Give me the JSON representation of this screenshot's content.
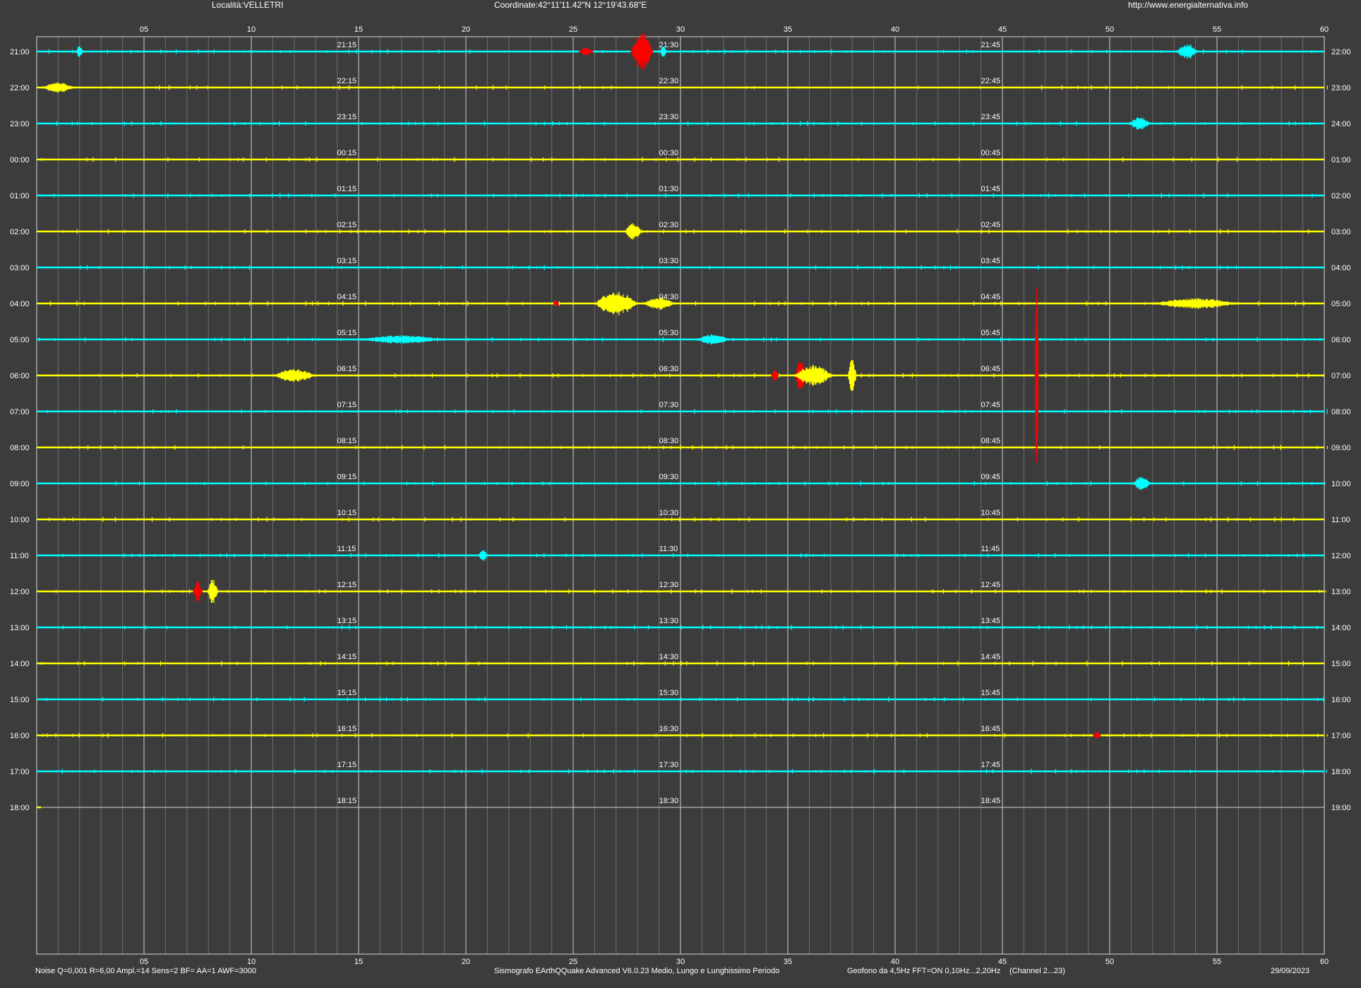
{
  "header": {
    "location": "Località:VELLETRI",
    "coordinates": "Coordinate:42°11'11.42\"N  12°19'43.68\"E",
    "website": "http://www.energialternativa.info"
  },
  "footer": {
    "params": "Noise Q=0,001 R=6,00 Ampl.=14 Sens=2 BF= AA=1 AWF=3000",
    "software": "Sismografo  EArthQQuake Advanced V6.0.23  Medio, Lungo e Lunghissimo Periodo",
    "sensor": "Geofono da 4,5Hz FFT=ON 0,10Hz...2,20Hz",
    "channel": "(Channel 2...23)",
    "date": "29/09/2023"
  },
  "colors": {
    "background": "#3c3c3c",
    "trace_a": "#00ffff",
    "trace_b": "#ffff00",
    "event": "#ff0000",
    "grid_major": "#cfcfcf",
    "grid_minor": "#6e6e6e"
  },
  "chart_data": {
    "type": "line",
    "description_of_axes": "helicorder",
    "x_axis": {
      "ticks": [
        "05",
        "10",
        "15",
        "20",
        "25",
        "30",
        "35",
        "40",
        "45",
        "50",
        "55",
        "60"
      ],
      "range": [
        0,
        60
      ],
      "unit_label": ""
    },
    "rows": [
      {
        "start": "21:00",
        "end": "22:00",
        "q1": "21:15",
        "q2": "21:30",
        "q3": "21:45",
        "color": "cyan"
      },
      {
        "start": "22:00",
        "end": "23:00",
        "q1": "22:15",
        "q2": "22:30",
        "q3": "22:45",
        "color": "yellow"
      },
      {
        "start": "23:00",
        "end": "24:00",
        "q1": "23:15",
        "q2": "23:30",
        "q3": "23:45",
        "color": "cyan"
      },
      {
        "start": "00:00",
        "end": "01:00",
        "q1": "00:15",
        "q2": "00:30",
        "q3": "00:45",
        "color": "yellow"
      },
      {
        "start": "01:00",
        "end": "02:00",
        "q1": "01:15",
        "q2": "01:30",
        "q3": "01:45",
        "color": "cyan"
      },
      {
        "start": "02:00",
        "end": "03:00",
        "q1": "02:15",
        "q2": "02:30",
        "q3": "02:45",
        "color": "yellow"
      },
      {
        "start": "03:00",
        "end": "04:00",
        "q1": "03:15",
        "q2": "03:30",
        "q3": "03:45",
        "color": "cyan"
      },
      {
        "start": "04:00",
        "end": "05:00",
        "q1": "04:15",
        "q2": "04:30",
        "q3": "04:45",
        "color": "yellow"
      },
      {
        "start": "05:00",
        "end": "06:00",
        "q1": "05:15",
        "q2": "05:30",
        "q3": "05:45",
        "color": "cyan"
      },
      {
        "start": "06:00",
        "end": "07:00",
        "q1": "06:15",
        "q2": "06:30",
        "q3": "06:45",
        "color": "yellow"
      },
      {
        "start": "07:00",
        "end": "08:00",
        "q1": "07:15",
        "q2": "07:30",
        "q3": "07:45",
        "color": "cyan"
      },
      {
        "start": "08:00",
        "end": "09:00",
        "q1": "08:15",
        "q2": "08:30",
        "q3": "08:45",
        "color": "yellow"
      },
      {
        "start": "09:00",
        "end": "10:00",
        "q1": "09:15",
        "q2": "09:30",
        "q3": "09:45",
        "color": "cyan"
      },
      {
        "start": "10:00",
        "end": "11:00",
        "q1": "10:15",
        "q2": "10:30",
        "q3": "10:45",
        "color": "yellow"
      },
      {
        "start": "11:00",
        "end": "12:00",
        "q1": "11:15",
        "q2": "11:30",
        "q3": "11:45",
        "color": "cyan"
      },
      {
        "start": "12:00",
        "end": "13:00",
        "q1": "12:15",
        "q2": "12:30",
        "q3": "12:45",
        "color": "yellow"
      },
      {
        "start": "13:00",
        "end": "14:00",
        "q1": "13:15",
        "q2": "13:30",
        "q3": "13:45",
        "color": "cyan"
      },
      {
        "start": "14:00",
        "end": "15:00",
        "q1": "14:15",
        "q2": "14:30",
        "q3": "14:45",
        "color": "yellow"
      },
      {
        "start": "15:00",
        "end": "16:00",
        "q1": "15:15",
        "q2": "15:30",
        "q3": "15:45",
        "color": "cyan"
      },
      {
        "start": "16:00",
        "end": "17:00",
        "q1": "16:15",
        "q2": "16:30",
        "q3": "16:45",
        "color": "yellow"
      },
      {
        "start": "17:00",
        "end": "18:00",
        "q1": "17:15",
        "q2": "17:30",
        "q3": "17:45",
        "color": "cyan"
      },
      {
        "start": "18:00",
        "end": "19:00",
        "q1": "18:15",
        "q2": "18:30",
        "q3": "18:45",
        "color": "yellow"
      }
    ],
    "trace_extent_last_row_minutes": 0.2,
    "events": [
      {
        "row": 0,
        "minute": 2.0,
        "amp": 0.18,
        "dur": 0.3,
        "color": "cyan"
      },
      {
        "row": 0,
        "minute": 25.6,
        "amp": 0.12,
        "dur": 0.6,
        "color": "red"
      },
      {
        "row": 0,
        "minute": 28.2,
        "amp": 0.55,
        "dur": 1.0,
        "color": "red"
      },
      {
        "row": 0,
        "minute": 29.2,
        "amp": 0.2,
        "dur": 0.3,
        "color": "cyan"
      },
      {
        "row": 0,
        "minute": 53.6,
        "amp": 0.22,
        "dur": 1.0,
        "color": "cyan"
      },
      {
        "row": 1,
        "minute": 1.0,
        "amp": 0.15,
        "dur": 1.5,
        "color": "yellow"
      },
      {
        "row": 2,
        "minute": 51.4,
        "amp": 0.18,
        "dur": 1.0,
        "color": "cyan"
      },
      {
        "row": 5,
        "minute": 27.8,
        "amp": 0.25,
        "dur": 0.8,
        "color": "yellow"
      },
      {
        "row": 7,
        "minute": 24.2,
        "amp": 0.12,
        "dur": 0.2,
        "color": "red"
      },
      {
        "row": 7,
        "minute": 27.0,
        "amp": 0.35,
        "dur": 2.0,
        "color": "yellow"
      },
      {
        "row": 7,
        "minute": 29.0,
        "amp": 0.18,
        "dur": 1.5,
        "color": "yellow"
      },
      {
        "row": 7,
        "minute": 54.0,
        "amp": 0.15,
        "dur": 4.0,
        "color": "yellow"
      },
      {
        "row": 8,
        "minute": 17.0,
        "amp": 0.12,
        "dur": 4.0,
        "color": "cyan"
      },
      {
        "row": 8,
        "minute": 31.5,
        "amp": 0.15,
        "dur": 1.5,
        "color": "cyan"
      },
      {
        "row": 9,
        "minute": 12.0,
        "amp": 0.18,
        "dur": 2.0,
        "color": "yellow"
      },
      {
        "row": 9,
        "minute": 34.4,
        "amp": 0.18,
        "dur": 0.3,
        "color": "red"
      },
      {
        "row": 9,
        "minute": 35.6,
        "amp": 0.45,
        "dur": 0.5,
        "color": "red"
      },
      {
        "row": 9,
        "minute": 36.2,
        "amp": 0.3,
        "dur": 1.8,
        "color": "yellow"
      },
      {
        "row": 9,
        "minute": 38.0,
        "amp": 0.5,
        "dur": 0.4,
        "color": "yellow"
      },
      {
        "row": 9,
        "minute": 46.6,
        "amp": 2.7,
        "dur": 0.15,
        "color": "red"
      },
      {
        "row": 10,
        "minute": 46.6,
        "amp": 1.4,
        "dur": 0.1,
        "color": "red"
      },
      {
        "row": 12,
        "minute": 51.5,
        "amp": 0.2,
        "dur": 0.8,
        "color": "cyan"
      },
      {
        "row": 14,
        "minute": 20.8,
        "amp": 0.18,
        "dur": 0.4,
        "color": "cyan"
      },
      {
        "row": 15,
        "minute": 7.5,
        "amp": 0.3,
        "dur": 0.4,
        "color": "red"
      },
      {
        "row": 15,
        "minute": 8.2,
        "amp": 0.35,
        "dur": 0.5,
        "color": "yellow"
      },
      {
        "row": 19,
        "minute": 49.4,
        "amp": 0.1,
        "dur": 0.3,
        "color": "red"
      }
    ]
  }
}
